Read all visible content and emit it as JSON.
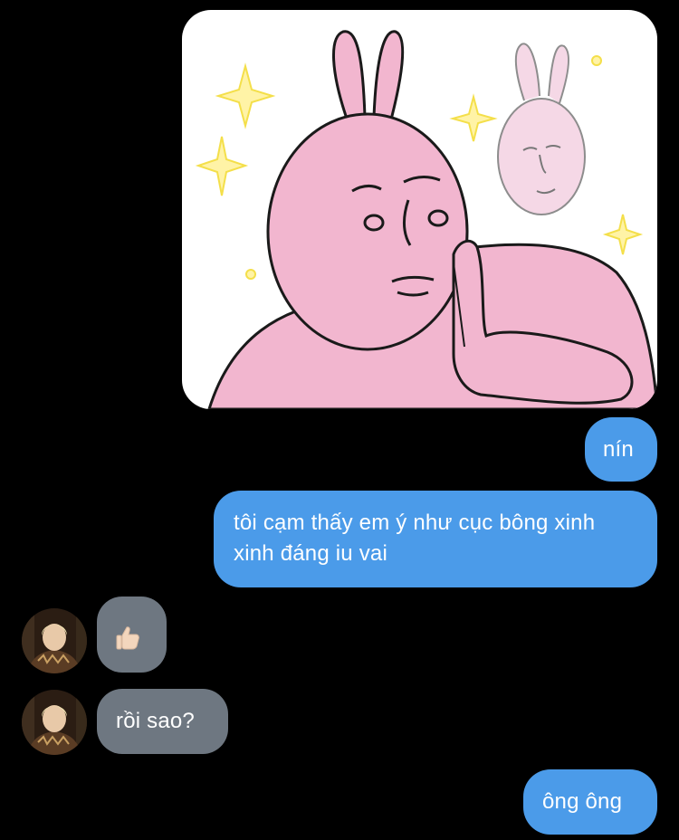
{
  "messages": [
    {
      "type": "sticker",
      "direction": "outgoing",
      "icon": "rabbit-sticker-icon"
    },
    {
      "type": "text",
      "direction": "outgoing",
      "text": "nín"
    },
    {
      "type": "text",
      "direction": "outgoing",
      "text": "tôi cạm thấy em ý như cục bông xinh xinh đáng iu vai"
    },
    {
      "type": "reaction",
      "direction": "incoming",
      "icon": "thumbs-up-icon",
      "avatar": "contact-avatar"
    },
    {
      "type": "text",
      "direction": "incoming",
      "text": "rồi sao?",
      "avatar": "contact-avatar"
    },
    {
      "type": "text",
      "direction": "outgoing",
      "text": "ông ông"
    }
  ],
  "colors": {
    "background": "#000000",
    "outgoing_bubble": "#4b9be9",
    "incoming_bubble": "#6e7781",
    "bubble_text": "#ffffff",
    "sticker_pink": "#f2b6cf"
  }
}
